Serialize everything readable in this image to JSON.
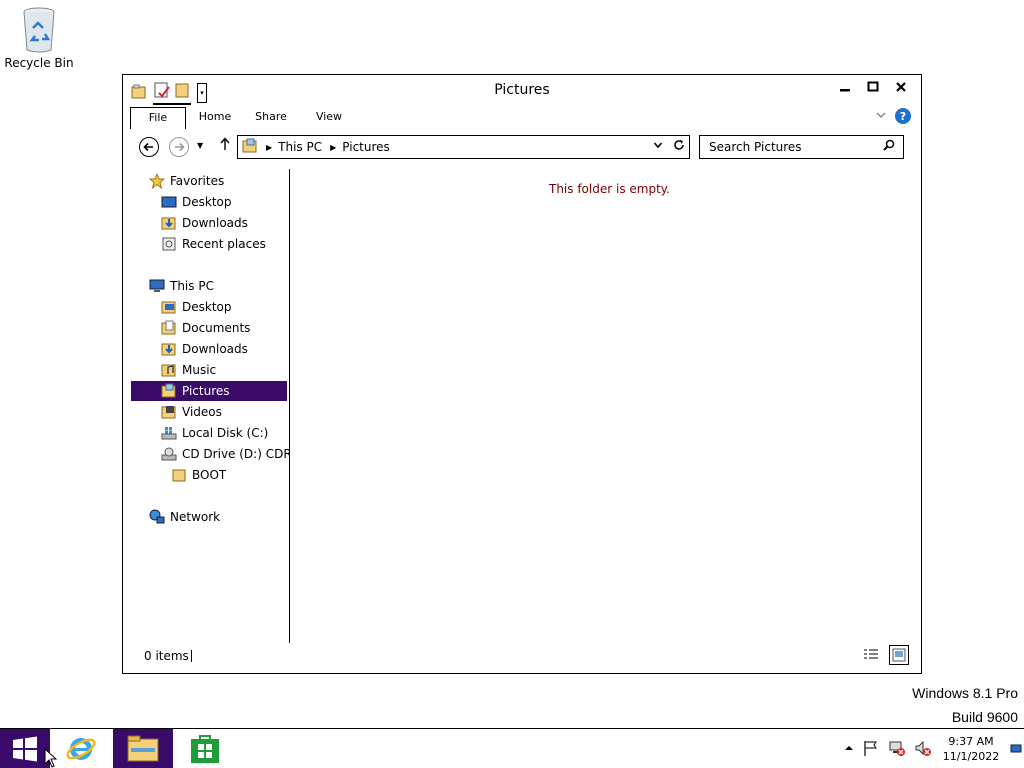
{
  "desktop": {
    "recycle_bin_label": "Recycle Bin",
    "watermark_line1": "Windows 8.1 Pro",
    "watermark_line2": "Build 9600"
  },
  "window": {
    "title": "Pictures",
    "controls": {
      "minimize": "minimize-icon",
      "maximize": "maximize-icon",
      "close": "close-icon"
    }
  },
  "ribbon": {
    "tabs": [
      "File",
      "Home",
      "Share",
      "View"
    ]
  },
  "address": {
    "crumbs": [
      "This PC",
      "Pictures"
    ]
  },
  "search": {
    "placeholder": "Search Pictures"
  },
  "nav_tree": {
    "favorites": {
      "label": "Favorites",
      "items": [
        "Desktop",
        "Downloads",
        "Recent places"
      ]
    },
    "this_pc": {
      "label": "This PC",
      "items": [
        "Desktop",
        "Documents",
        "Downloads",
        "Music",
        "Pictures",
        "Videos",
        "Local Disk (C:)",
        "CD Drive (D:) CDROM"
      ]
    },
    "cd_children": [
      "BOOT"
    ],
    "network": "Network",
    "selected": "Pictures"
  },
  "content": {
    "empty_message": "This folder is empty."
  },
  "status": {
    "item_count": "0 items"
  },
  "taskbar": {
    "clock_time": "9:37 AM",
    "clock_date": "11/1/2022",
    "accent": "#3a0a6b"
  }
}
